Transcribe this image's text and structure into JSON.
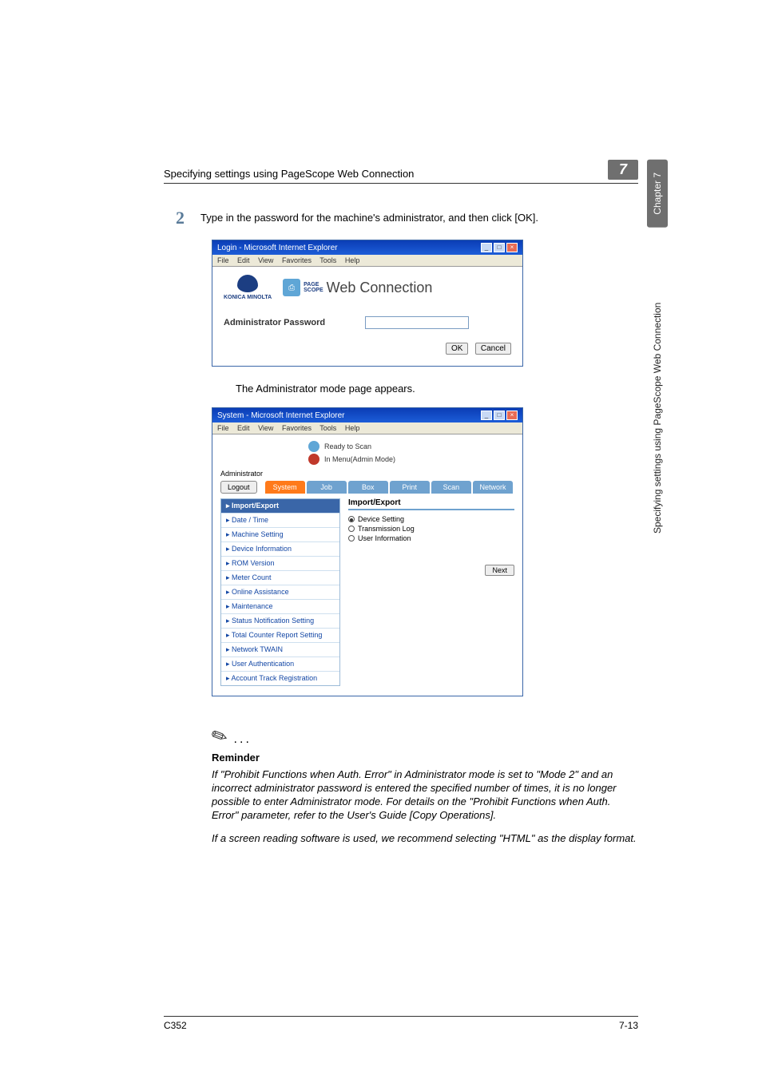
{
  "page": {
    "header_title": "Specifying settings using PageScope Web Connection",
    "chapter_number": "7",
    "chapter_label": "Chapter 7",
    "side_title": "Specifying settings using PageScope Web Connection",
    "footer_left": "C352",
    "footer_right": "7-13"
  },
  "step2": {
    "number": "2",
    "text": "Type in the password for the machine's administrator, and then click [OK]."
  },
  "ss1": {
    "title": "Login - Microsoft Internet Explorer",
    "menu": {
      "file": "File",
      "edit": "Edit",
      "view": "View",
      "fav": "Favorites",
      "tools": "Tools",
      "help": "Help"
    },
    "km_name": "KONICA MINOLTA",
    "ps_page": "PAGE",
    "ps_scope": "SCOPE",
    "wc": "Web Connection",
    "admin_pw_label": "Administrator Password",
    "ok": "OK",
    "cancel": "Cancel"
  },
  "after_ss1": "The Administrator mode page appears.",
  "ss2": {
    "title": "System - Microsoft Internet Explorer",
    "status1": "Ready to Scan",
    "status2": "In Menu(Admin Mode)",
    "admin_label": "Administrator",
    "logout": "Logout",
    "tabs": {
      "system": "System",
      "job": "Job",
      "box": "Box",
      "print": "Print",
      "scan": "Scan",
      "net": "Network"
    },
    "menu": [
      "Import/Export",
      "Date / Time",
      "Machine Setting",
      "Device Information",
      "ROM Version",
      "Meter Count",
      "Online Assistance",
      "Maintenance",
      "Status Notification Setting",
      "Total Counter Report Setting",
      "Network TWAIN",
      "User Authentication",
      "Account Track Registration"
    ],
    "panel_head": "Import/Export",
    "opts": {
      "dev": "Device Setting",
      "tl": "Transmission Log",
      "ui": "User Information"
    },
    "next": "Next"
  },
  "note": {
    "title": "Reminder",
    "body1": "If \"Prohibit Functions when Auth. Error\" in Administrator mode is set to \"Mode 2\" and an incorrect administrator password is entered the specified number of times, it is no longer possible to enter Administrator mode. For details on the \"Prohibit Functions when Auth. Error\" parameter, refer to the User's Guide [Copy Operations].",
    "body2": "If a screen reading software is used, we recommend selecting \"HTML\" as the display format."
  }
}
